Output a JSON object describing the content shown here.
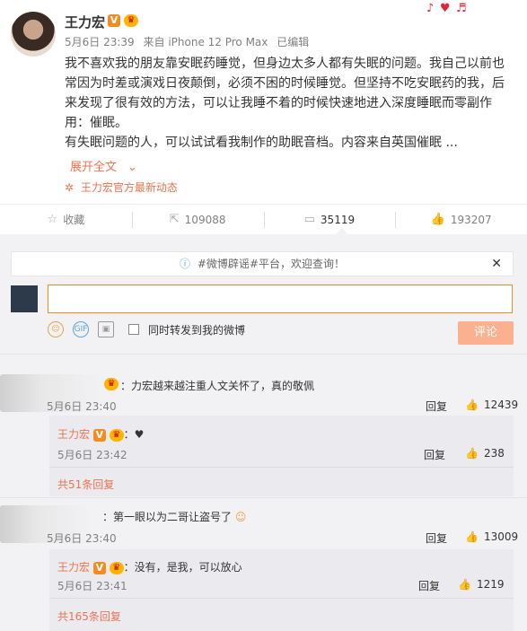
{
  "post": {
    "author": "王力宏",
    "meta": {
      "date": "5月6日 23:39",
      "device": "来自 iPhone 12 Pro Max",
      "edited": "已编辑"
    },
    "body_lines": [
      "我不喜欢我的朋友靠安眠药睡觉，但身边太多人都有失眠的问题。我自己以前也",
      "常因为时差或演戏日夜颠倒，必须不困的时候睡觉。但坚持不吃安眠药的我，后",
      "来发现了很有效的方法，可以让我睡不着的时候快速地进入深度睡眠而零副作",
      "用：催眠。",
      "有失眠问题的人，可以试试看我制作的助眠音档。内容来自英国催眠 ..."
    ],
    "expand": "展开全文",
    "source": "王力宏官方最新动态"
  },
  "actions": {
    "favorite": "收藏",
    "forward": "109088",
    "comment": "35119",
    "like": "193207"
  },
  "comment_box": {
    "notice": "#微博辟谣#平台，欢迎查询！",
    "placeholder": "",
    "sync_label": "同时转发到我的微博",
    "submit": "评论"
  },
  "comments": [
    {
      "text": "：力宏越来越注重人文关怀了，真的敬佩",
      "time": "5月6日 23:40",
      "reply": "回复",
      "likes": "12439",
      "sub": {
        "author": "王力宏",
        "text": "：♥",
        "time": "5月6日 23:42",
        "reply": "回复",
        "likes": "238"
      },
      "more": "共51条回复"
    },
    {
      "text": "：第一眼以为二哥让盗号了",
      "time": "5月6日 23:40",
      "reply": "回复",
      "likes": "13009",
      "sub": {
        "author": "王力宏",
        "text": "：没有，是我，可以放心",
        "time": "5月6日 23:41",
        "reply": "回复",
        "likes": "1219"
      },
      "more": "共165条回复"
    }
  ],
  "colors": {
    "accent": "#eb7350",
    "panel_bg": "#f2f2f5",
    "submit_bg": "#fbb18f"
  }
}
